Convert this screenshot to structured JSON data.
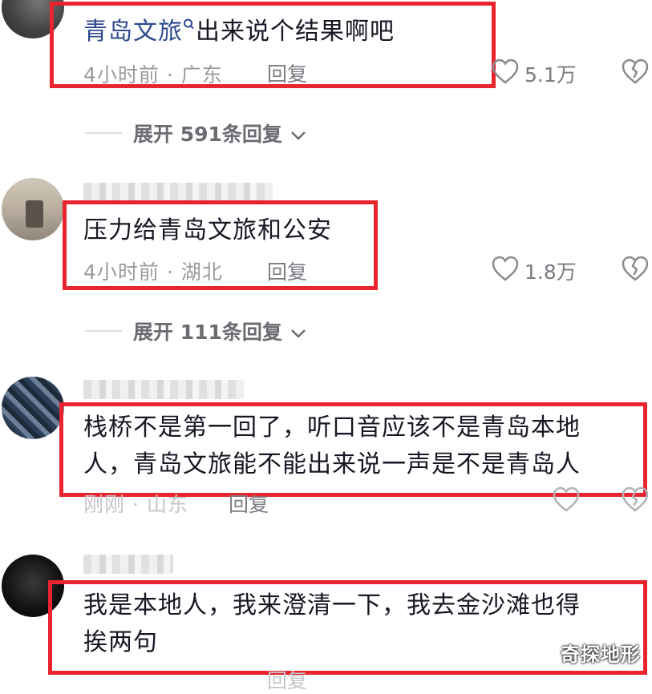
{
  "comments": [
    {
      "link_text": "青岛文旅",
      "text": "出来说个结果啊吧",
      "location": "4小时前 · 广东",
      "reply": "回复",
      "likes": "5.1万"
    },
    {
      "text": "压力给青岛文旅和公安",
      "location": "4小时前 · 湖北",
      "reply": "回复",
      "likes": "1.8万"
    },
    {
      "text_line1": "栈桥不是第一回了，听口音应该不是青岛本地",
      "text_line2": "人，青岛文旅能不能出来说一声是不是青岛人",
      "location": "刚刚 · 山东",
      "reply": "回复"
    },
    {
      "text_line1": "我是本地人，我来澄清一下，我去金沙滩也得",
      "text_line2": "挨两句",
      "reply": "回复"
    }
  ],
  "expand_replies": [
    "展开 591条回复",
    "展开 111条回复"
  ],
  "icons": {
    "like": "heart-icon",
    "dislike": "broken-heart-icon",
    "expand": "chevron-down-icon",
    "search": "search-icon"
  },
  "colors": {
    "highlight_box": "#e8242e",
    "link": "#2f4a8f",
    "meta": "#9a9ba0"
  },
  "watermark": "奇探地形"
}
